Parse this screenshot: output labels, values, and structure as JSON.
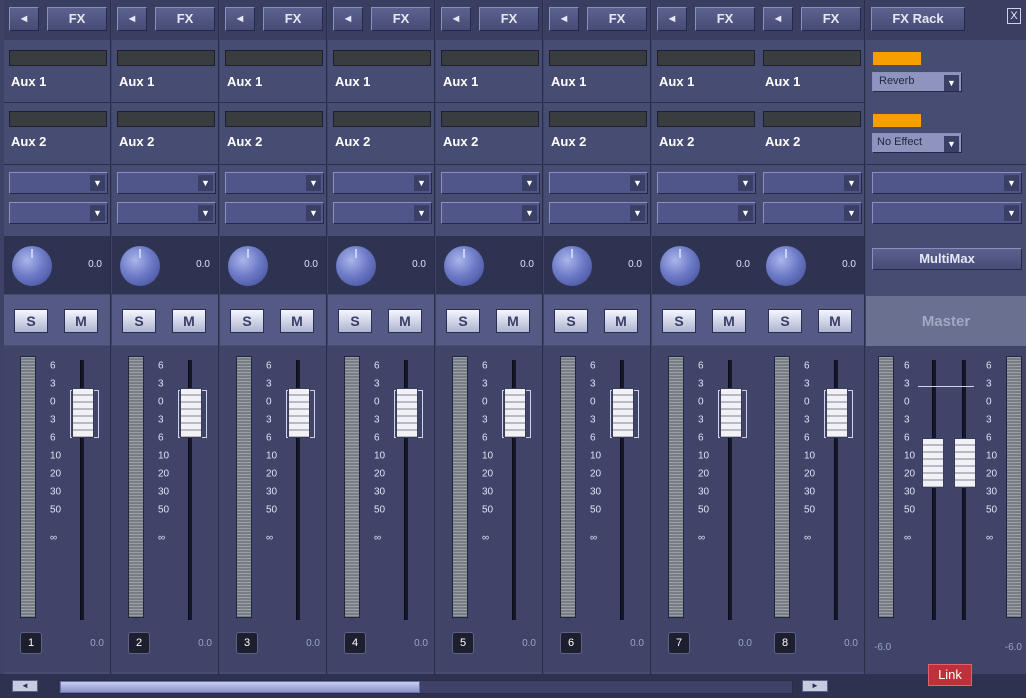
{
  "channels": [
    {
      "num": "1",
      "fx": "FX",
      "arrow": "◄",
      "aux1": "Aux 1",
      "aux2": "Aux 2",
      "pan": "0.0",
      "solo": "S",
      "mute": "M",
      "fader": "0.0"
    },
    {
      "num": "2",
      "fx": "FX",
      "arrow": "◄",
      "aux1": "Aux 1",
      "aux2": "Aux 2",
      "pan": "0.0",
      "solo": "S",
      "mute": "M",
      "fader": "0.0"
    },
    {
      "num": "3",
      "fx": "FX",
      "arrow": "◄",
      "aux1": "Aux 1",
      "aux2": "Aux 2",
      "pan": "0.0",
      "solo": "S",
      "mute": "M",
      "fader": "0.0"
    },
    {
      "num": "4",
      "fx": "FX",
      "arrow": "◄",
      "aux1": "Aux 1",
      "aux2": "Aux 2",
      "pan": "0.0",
      "solo": "S",
      "mute": "M",
      "fader": "0.0"
    },
    {
      "num": "5",
      "fx": "FX",
      "arrow": "◄",
      "aux1": "Aux 1",
      "aux2": "Aux 2",
      "pan": "0.0",
      "solo": "S",
      "mute": "M",
      "fader": "0.0"
    },
    {
      "num": "6",
      "fx": "FX",
      "arrow": "◄",
      "aux1": "Aux 1",
      "aux2": "Aux 2",
      "pan": "0.0",
      "solo": "S",
      "mute": "M",
      "fader": "0.0"
    },
    {
      "num": "7",
      "fx": "FX",
      "arrow": "◄",
      "aux1": "Aux 1",
      "aux2": "Aux 2",
      "pan": "0.0",
      "solo": "S",
      "mute": "M",
      "fader": "0.0"
    },
    {
      "num": "8",
      "fx": "FX",
      "arrow": "◄",
      "aux1": "Aux 1",
      "aux2": "Aux 2",
      "pan": "0.0",
      "solo": "S",
      "mute": "M",
      "fader": "0.0"
    }
  ],
  "scale_labels": [
    "6",
    "3",
    "0",
    "3",
    "6",
    "10",
    "20",
    "30",
    "50",
    "∞"
  ],
  "master_scale_left": [
    "6",
    "3",
    "0",
    "3",
    "6",
    "10",
    "20",
    "30",
    "50",
    "∞"
  ],
  "master_scale_right": [
    "6",
    "3",
    "0",
    "3",
    "6",
    "10",
    "20",
    "30",
    "50",
    "∞"
  ],
  "fx_rack": {
    "title": "FX Rack",
    "close": "X",
    "slot1": "Reverb",
    "slot2": "No Effect",
    "multimax": "MultiMax",
    "master": "Master",
    "left_val": "-6.0",
    "right_val": "-6.0",
    "link": "Link"
  },
  "dropdown_arrow": "▼",
  "scroll": {
    "left": "◄",
    "right": "►"
  },
  "colors": {
    "accent_orange": "#f5a000",
    "link_red": "#c0303a",
    "highlight": "#d01818"
  }
}
